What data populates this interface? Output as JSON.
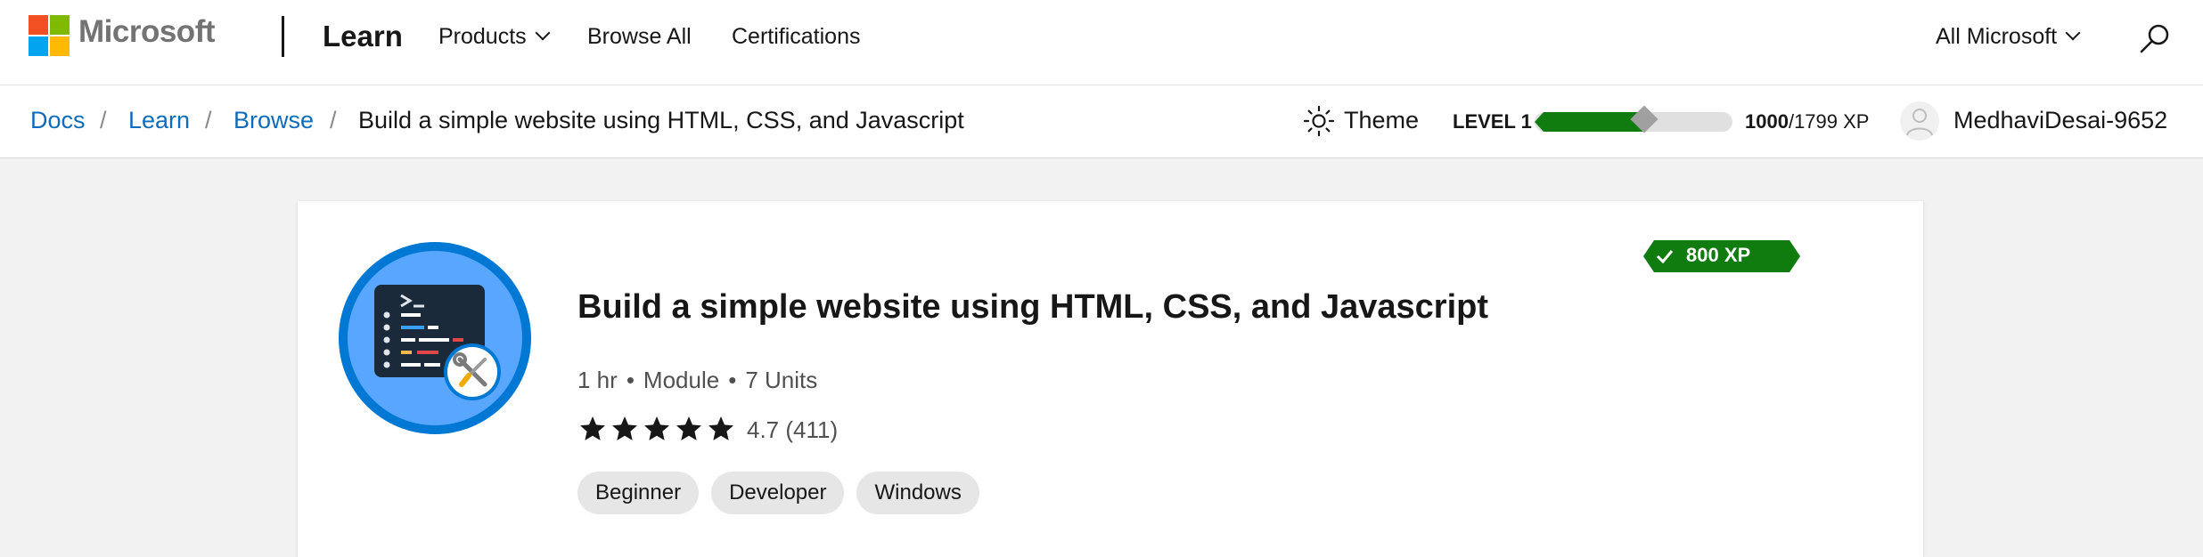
{
  "header": {
    "brand": "Microsoft",
    "section": "Learn",
    "nav": [
      {
        "label": "Products",
        "has_dropdown": true
      },
      {
        "label": "Browse All",
        "has_dropdown": false
      },
      {
        "label": "Certifications",
        "has_dropdown": false
      }
    ],
    "all_microsoft": "All Microsoft",
    "search_icon": "search-icon"
  },
  "breadcrumb": {
    "items": [
      "Docs",
      "Learn",
      "Browse"
    ],
    "separator": "/",
    "current": "Build a simple website using HTML, CSS, and Javascript"
  },
  "profile": {
    "theme_label": "Theme",
    "level": "LEVEL 1",
    "xp_current": "1000",
    "xp_total": "/1799 XP",
    "xp_fraction": 0.556,
    "username": "MedhaviDesai-9652"
  },
  "module": {
    "xp_badge": "800 XP",
    "title": "Build a simple website using HTML, CSS, and Javascript",
    "duration": "1 hr",
    "type": "Module",
    "units": "7 Units",
    "separator": "•",
    "stars": 5,
    "rating": "4.7 (411)",
    "tags": [
      "Beginner",
      "Developer",
      "Windows"
    ]
  },
  "colors": {
    "link": "#0f6cbd",
    "progress": "#107c10",
    "badge": "#107c10",
    "icon_ring": "#0078d4",
    "icon_fill": "#59a6ff"
  }
}
